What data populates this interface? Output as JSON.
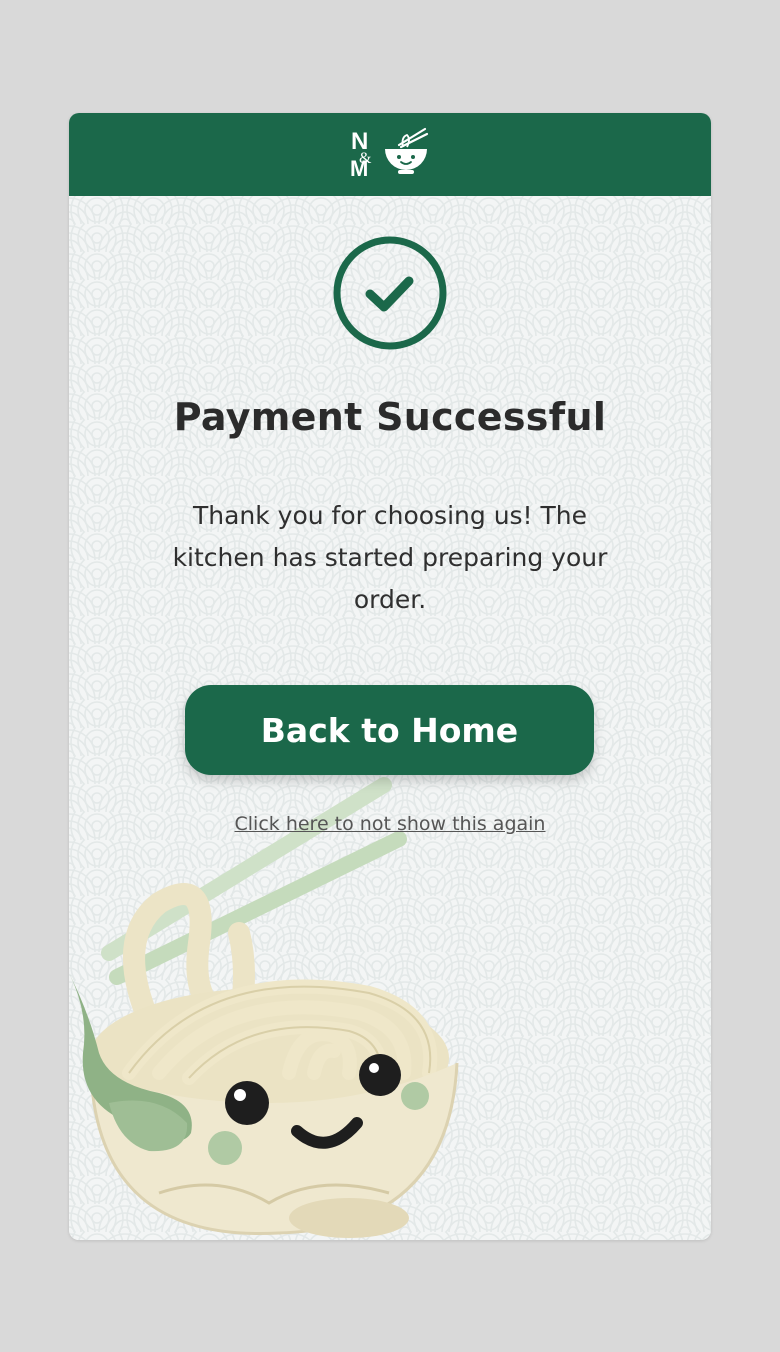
{
  "header": {
    "logo_text_top": "N",
    "logo_text_amp": "&",
    "logo_text_bottom": "M"
  },
  "success_icon": "check-circle-icon",
  "title": "Payment Successful",
  "message": "Thank you for choosing us! The kitchen has started preparing your order.",
  "primary_button": "Back to Home",
  "dismiss_link": "Click here to not show this again",
  "colors": {
    "brand": "#1b684a",
    "background": "#f3f5f5",
    "page": "#d9d9d9",
    "text": "#2b2b2b"
  },
  "illustration": "noodle-bowl-mascot"
}
